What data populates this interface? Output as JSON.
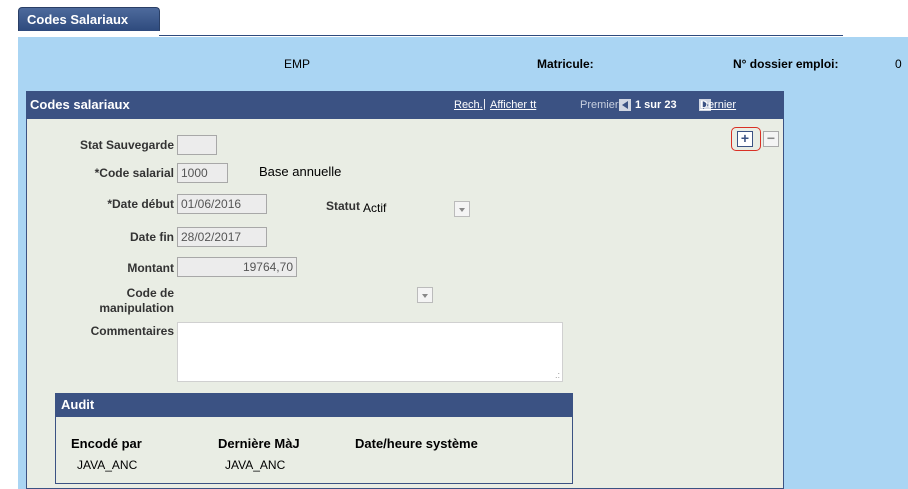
{
  "tab": {
    "label": "Codes Salariaux"
  },
  "header": {
    "emp_label": "EMP",
    "matricule_label": "Matricule:",
    "dossier_label": "N° dossier emploi:",
    "dossier_value": "0"
  },
  "grid": {
    "title": "Codes salariaux",
    "search_link": "Rech.",
    "separator": "|",
    "show_all_link": "Afficher tt",
    "first_label": "Premier",
    "count": "1 sur 23",
    "last_link": "Dernier",
    "add_symbol": "+",
    "remove_symbol": "−"
  },
  "form": {
    "stat_sauvegarde": {
      "label": "Stat Sauvegarde",
      "value": ""
    },
    "code_salarial": {
      "label": "*Code salarial",
      "value": "1000",
      "description": "Base annuelle"
    },
    "date_debut": {
      "label": "*Date début",
      "value": "01/06/2016"
    },
    "statut": {
      "label": "Statut",
      "value": "Actif"
    },
    "date_fin": {
      "label": "Date fin",
      "value": "28/02/2017"
    },
    "montant": {
      "label": "Montant",
      "value": "19764,70"
    },
    "code_manipulation": {
      "label_line1": "Code de",
      "label_line2": "manipulation",
      "value": ""
    },
    "commentaires": {
      "label": "Commentaires",
      "value": ""
    }
  },
  "audit": {
    "title": "Audit",
    "columns": [
      "Encodé par",
      "Dernière MàJ",
      "Date/heure système"
    ],
    "values": [
      "JAVA_ANC",
      "JAVA_ANC",
      ""
    ]
  },
  "colors": {
    "tab_bg": "#2e4a7d",
    "header_band": "#aad5f3",
    "grid_header": "#3b5283",
    "panel_bg": "#e9ede4",
    "highlight": "#d93025"
  }
}
